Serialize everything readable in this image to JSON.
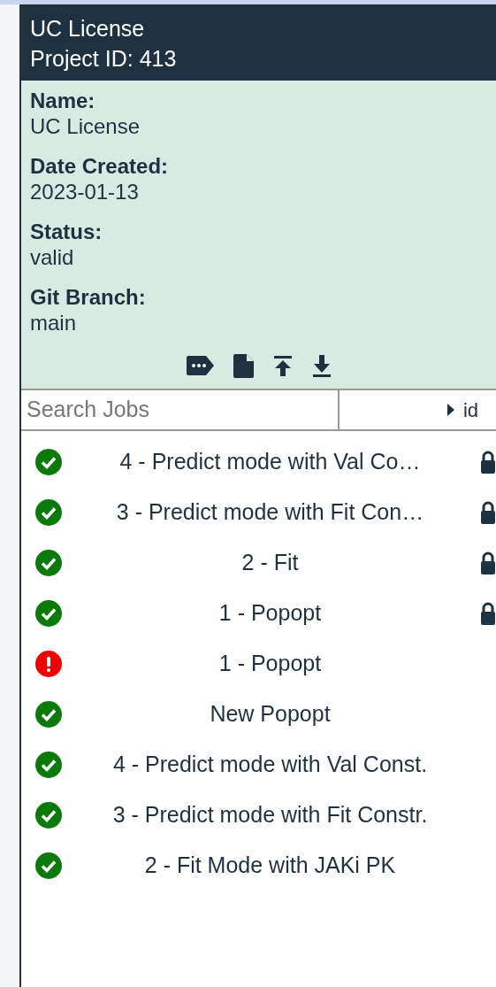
{
  "project": {
    "title": "UC License",
    "subtitle": "Project ID: 413"
  },
  "details": [
    {
      "label": "Name:",
      "value": "UC License"
    },
    {
      "label": "Date Created:",
      "value": "2023-01-13"
    },
    {
      "label": "Status:",
      "value": "valid"
    },
    {
      "label": "Git Branch:",
      "value": "main"
    }
  ],
  "toolbar": [
    {
      "kind": "tag"
    },
    {
      "kind": "file"
    },
    {
      "kind": "upload"
    },
    {
      "kind": "download"
    }
  ],
  "search": {
    "placeholder": "Search Jobs"
  },
  "sort": {
    "label": "id"
  },
  "jobs": [
    {
      "label": "4 - Predict mode with Val Co…",
      "failed": false,
      "locked": true
    },
    {
      "label": "3 - Predict mode with Fit Con…",
      "failed": false,
      "locked": true
    },
    {
      "label": "2 - Fit",
      "failed": false,
      "locked": true
    },
    {
      "label": "1 - Popopt",
      "failed": false,
      "locked": true
    },
    {
      "label": "1 - Popopt",
      "failed": true,
      "locked": false
    },
    {
      "label": "New Popopt",
      "failed": false,
      "locked": false
    },
    {
      "label": "4 - Predict mode with Val Const.",
      "failed": false,
      "locked": false
    },
    {
      "label": "3 - Predict mode with Fit Constr.",
      "failed": false,
      "locked": false
    },
    {
      "label": "2 - Fit Mode with JAKi PK",
      "failed": false,
      "locked": false
    }
  ]
}
